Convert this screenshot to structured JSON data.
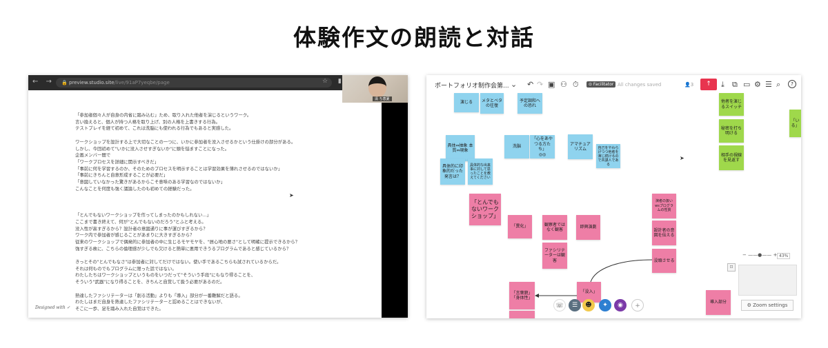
{
  "slide": {
    "title": "体験作文の朗読と対話"
  },
  "left": {
    "browser": {
      "nav": "← → ⟳",
      "url_host": "preview.studio.site",
      "url_path": "/live/91aP7yeqbe/page",
      "icons": "☆ ▮"
    },
    "webcam": {
      "name": "清 ち恵夏"
    },
    "paragraphs": [
      [
        "「参加者個々人が自身の内省に踏み込む」ため、取り入れた他者を演じるというワーク。",
        "言い換えると、個人が持つ人格を取り上げ、別の人格を上書きする行為。",
        "テストプレイを経て初めて、これは洗脳にも使われる行為でもあると実感した。"
      ],
      [
        "ワークショップを設計する上で大切なことの一つに、いかに参加者を没入させるかという仕掛けの部分がある。",
        "しかし、今回初めて\"いかに没入させすぎないか\"に頭を悩ますことになった。",
        "企画メンバー間で",
        "「ワークプロセスを詳細に開示すべきだ」",
        "「事前に何を学習するのか、そのためのプロセスを明示することは学習効果を薄れさせるのではないか」",
        "「事前にきちんと自意形成することが必要だ」",
        "「意図していなかった驚きがあるからこそ意味のある学習なのではないか」",
        "こんなことを何度も強く議論したのも初めての経験だった。"
      ],
      [
        "「とんでもないワークショップを作ってしまったのかもしれない...」",
        "ここまで書き終えて、何が\"とんでもないのだろう\"とふと考える。",
        "没入性が高すぎるから？設計者の意図通りに事が運びすぎるから？",
        "ワーク内で参加者が感じることがあまりに大きすぎるから？",
        "従来のワークショップで偶発的に参加者の中に生じるモヤモヤを、\"居心地の悪さ\"として明確に提示できるから？",
        "強すぎる故に、こちらの倫理感が少しでも欠けると簡単に悪用できうるプログラムであると感じているから？"
      ],
      [
        "きっとその\"とんでもなさ\"は参加者に対してだけではない。使い手であるこちらも試されているからだ。",
        "それは何ものでもプログラムに限った話ではない。",
        "わたしたちはワークショップというものをいつだって\"そういう手段\"にもなり得ることを、",
        "そういう\"武器\"になり得ることを、きちんと自覚して扱う必要があるのだ。"
      ],
      [
        "熟達したファシリテーターは「創る活動」よりも「導入」部分が一番難解だと語る。",
        "わたしはまだ自身を熟達したファシリテーターと認めることはできないが、",
        "そこに一歩、足を踏み入れた自覚はできた。"
      ]
    ],
    "footer": "Designed with ✓"
  },
  "right": {
    "toolbar": {
      "board_title": "ポートフォリオ制作会第...",
      "facilitator": "⊙ Facilitator",
      "saved": "All changes saved",
      "user_count": "👤3",
      "share_icon": "↑"
    },
    "stickies": [
      {
        "text": "演じる",
        "color": "blue"
      },
      {
        "text": "メタとベタの往復",
        "color": "blue"
      },
      {
        "text": "予定調和への恐れ",
        "color": "blue"
      },
      {
        "text": "具体⇔抽象\n本質⇔現象",
        "color": "blue"
      },
      {
        "text": "洗脳",
        "color": "blue"
      },
      {
        "text": "「心をあやつる方たち」\n◎◎",
        "color": "blue"
      },
      {
        "text": "アマチュアリズム",
        "color": "blue"
      },
      {
        "text": "自己をやわらげつつ他者を演じ続けるので共謀人である",
        "color": "blue"
      },
      {
        "text": "具体的に印象的だった発言は？",
        "color": "blue"
      },
      {
        "text": "具体的な出来事に対して思ったことを教えてください",
        "color": "blue"
      },
      {
        "text": "他者を演じるスイッチ",
        "color": "green"
      },
      {
        "text": "秘密を打ち明ける",
        "color": "green"
      },
      {
        "text": "相手の視線を見返す",
        "color": "green"
      },
      {
        "text": "「い\nる」",
        "color": "green"
      },
      {
        "text": "「とんでもないワークショップ」",
        "color": "pink"
      },
      {
        "text": "「異化」",
        "color": "pink"
      },
      {
        "text": "観察者ではなく観客",
        "color": "pink"
      },
      {
        "text": "即興演劇",
        "color": "pink"
      },
      {
        "text": "ファシリテーターは観客",
        "color": "pink"
      },
      {
        "text": "演者の扱いwsプログラムの性質",
        "color": "pink"
      },
      {
        "text": "設計者の意図を伝える",
        "color": "pink"
      },
      {
        "text": "没頭させる",
        "color": "pink"
      },
      {
        "text": "「言葉貌」\n「身体性」",
        "color": "pink"
      },
      {
        "text": "「没入」",
        "color": "pink"
      },
      {
        "text": "導入部分",
        "color": "pink"
      },
      {
        "text": "",
        "color": "pink"
      }
    ],
    "zoom": {
      "minus": "−",
      "plus": "+",
      "percent": "43%"
    },
    "zoom_settings": "⚙ Zoom settings"
  }
}
